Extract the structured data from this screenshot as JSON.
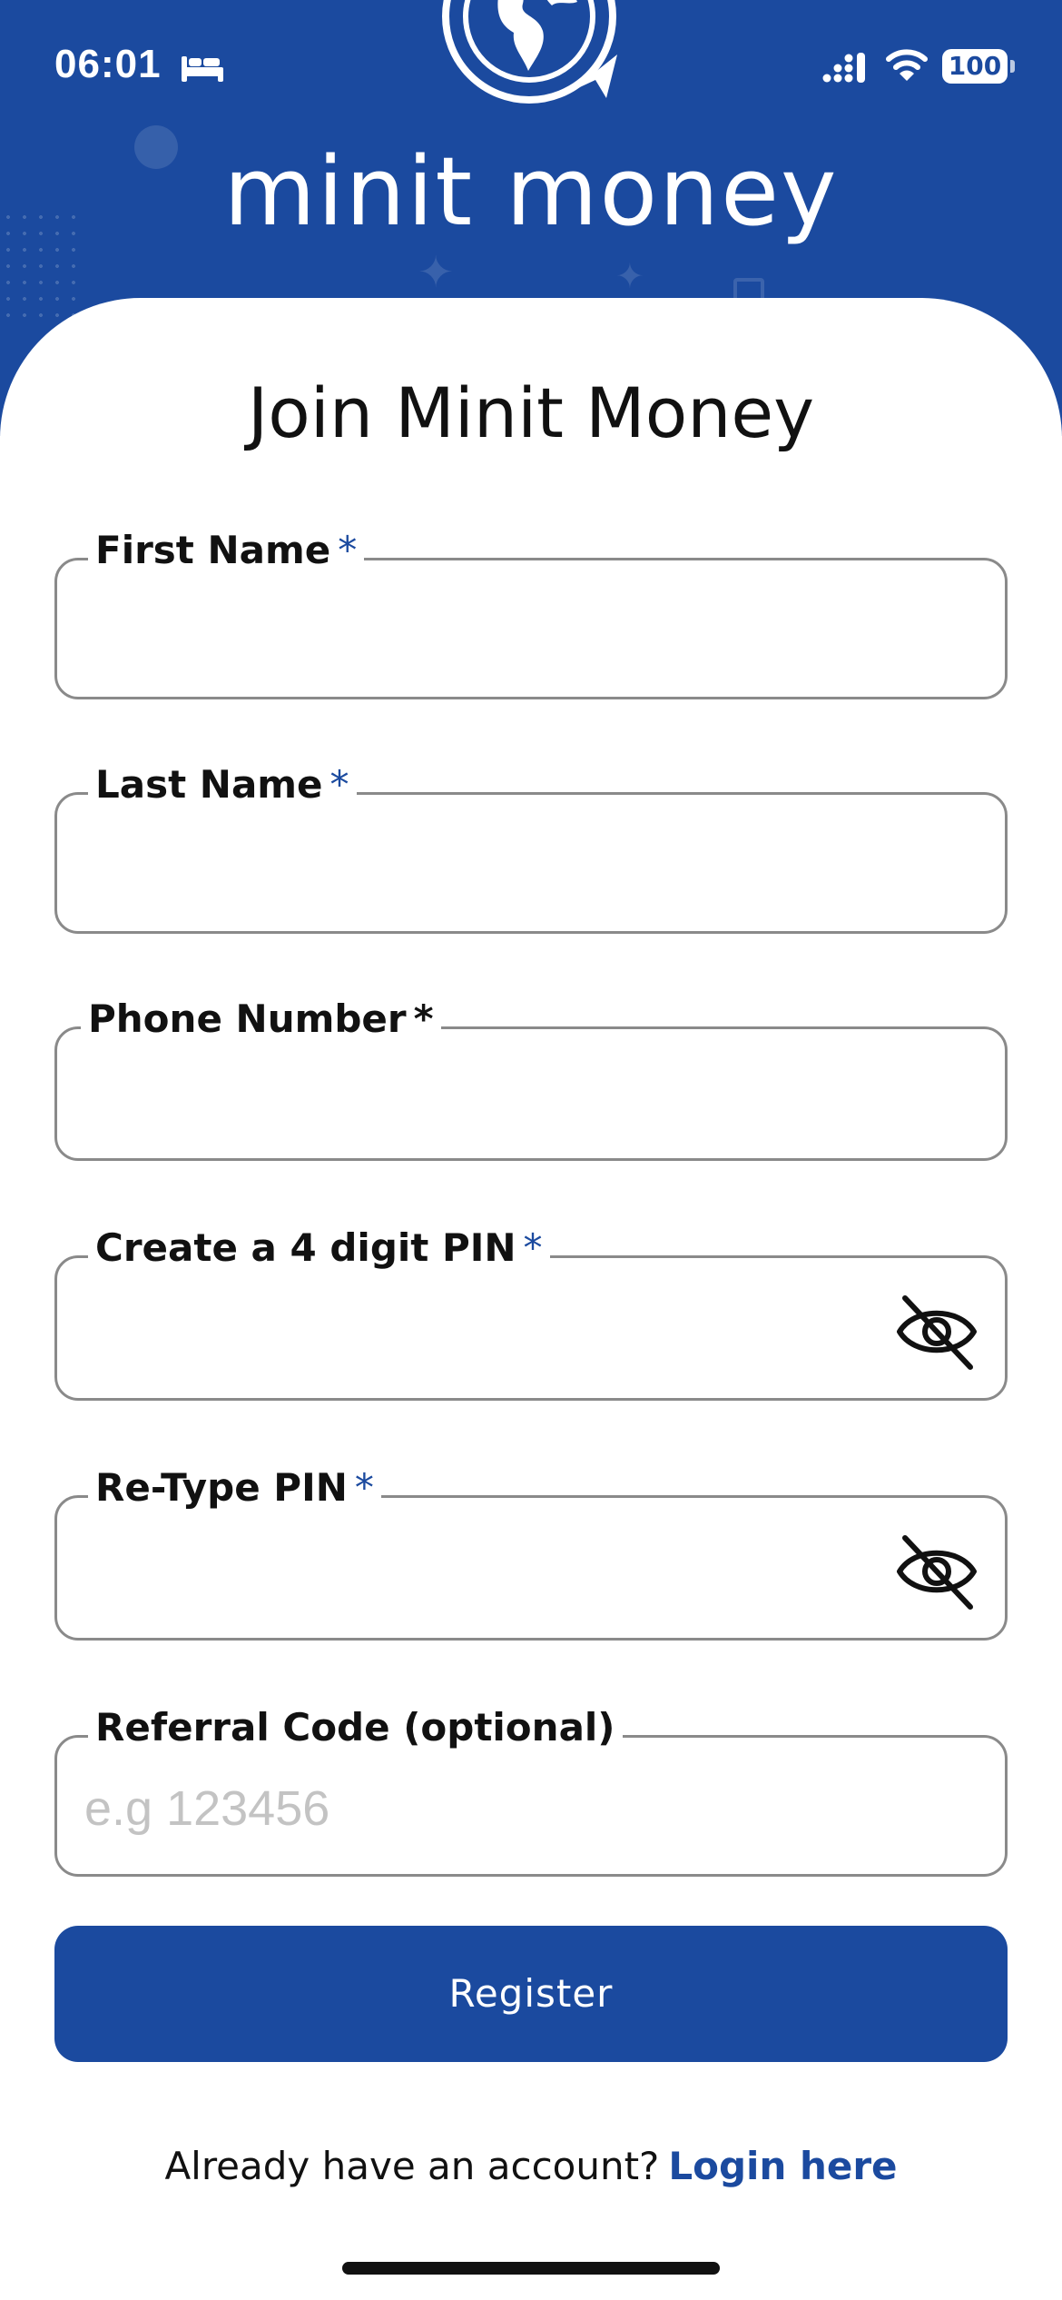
{
  "status_bar": {
    "time": "06:01",
    "battery": "100",
    "icons": [
      "bed-icon",
      "signal-icon",
      "wifi-icon",
      "battery-icon"
    ]
  },
  "brand": {
    "logo_icon": "globe-arrow-icon",
    "name": "minit money"
  },
  "page": {
    "title": "Join Minit Money"
  },
  "form": {
    "first_name": {
      "label": "First Name",
      "required_mark": "*",
      "value": ""
    },
    "last_name": {
      "label": "Last Name",
      "required_mark": "*",
      "value": ""
    },
    "phone_number": {
      "label": "Phone Number",
      "required_mark": "*",
      "value": ""
    },
    "pin": {
      "label": "Create a 4 digit PIN",
      "required_mark": "*",
      "value": "",
      "toggle_icon": "eye-off-icon"
    },
    "retype_pin": {
      "label": "Re-Type PIN",
      "required_mark": "*",
      "value": "",
      "toggle_icon": "eye-off-icon"
    },
    "referral_code": {
      "label": "Referral Code (optional)",
      "placeholder": "e.g 123456",
      "value": ""
    }
  },
  "register_button": "Register",
  "login_prompt": {
    "text": "Already have an account?",
    "link": "Login here"
  },
  "colors": {
    "brand_blue": "#1b4a9f",
    "text": "#111111",
    "border": "#8a8a8a",
    "placeholder": "#c3c3c3"
  }
}
